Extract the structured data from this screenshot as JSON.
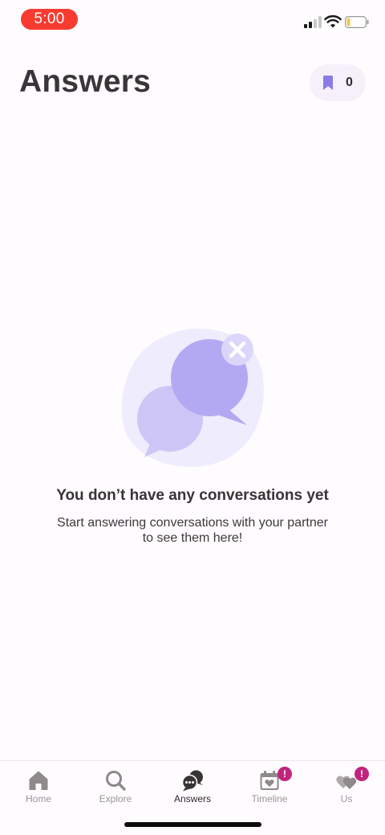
{
  "status_bar": {
    "time": "5:00"
  },
  "header": {
    "title": "Answers",
    "bookmark_count": "0"
  },
  "empty_state": {
    "title": "You don’t have any conversations yet",
    "subtitle_line1": "Start answering conversations with your partner",
    "subtitle_line2": "to see them here!"
  },
  "tabs": [
    {
      "label": "Home",
      "icon": "home-icon",
      "active": false,
      "badge": ""
    },
    {
      "label": "Explore",
      "icon": "search-icon",
      "active": false,
      "badge": ""
    },
    {
      "label": "Answers",
      "icon": "chat-bubbles-icon",
      "active": true,
      "badge": ""
    },
    {
      "label": "Timeline",
      "icon": "calendar-heart-icon",
      "active": false,
      "badge": "!"
    },
    {
      "label": "Us",
      "icon": "hearts-icon",
      "active": false,
      "badge": "!"
    }
  ],
  "colors": {
    "accent": "#8a7ce8",
    "bubble_dark": "#b3a9f2",
    "bubble_light": "#cdc6f6",
    "blob": "#eeecfd",
    "badge": "#c2247d",
    "status_pill": "#f83b30"
  }
}
